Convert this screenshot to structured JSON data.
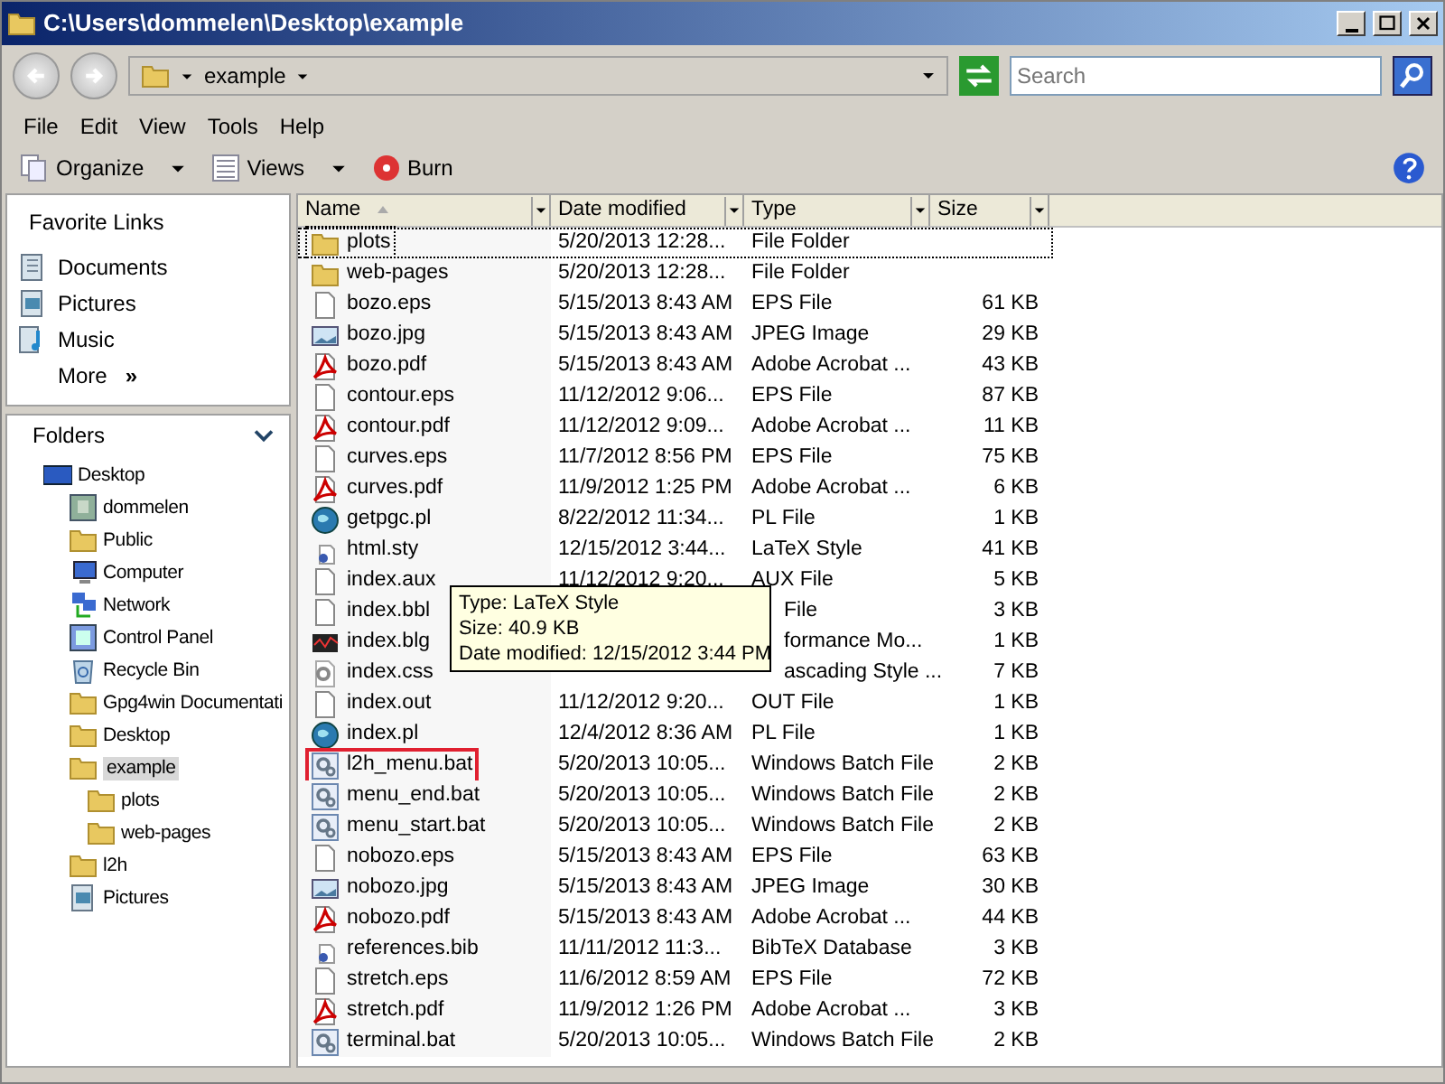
{
  "window": {
    "title": "C:\\Users\\dommelen\\Desktop\\example"
  },
  "address": {
    "path": "example",
    "search_placeholder": "Search"
  },
  "menu": [
    "File",
    "Edit",
    "View",
    "Tools",
    "Help"
  ],
  "toolbar": [
    {
      "label": "Organize",
      "kind": "menu"
    },
    {
      "label": "Views",
      "kind": "menu"
    },
    {
      "label": "Burn",
      "kind": "plain"
    }
  ],
  "favorites": {
    "title": "Favorite Links",
    "items": [
      {
        "label": "Documents",
        "kind": "documents"
      },
      {
        "label": "Pictures",
        "kind": "pictures"
      },
      {
        "label": "Music",
        "kind": "music"
      }
    ],
    "more": "More",
    "more_glyph": "»"
  },
  "folders": {
    "title": "Folders",
    "tree": [
      {
        "label": "Desktop",
        "kind": "desktop",
        "selected": false,
        "children": [
          {
            "label": "dommelen",
            "kind": "user",
            "selected": false
          },
          {
            "label": "Public",
            "kind": "folder",
            "selected": false
          },
          {
            "label": "Computer",
            "kind": "computer",
            "selected": false
          },
          {
            "label": "Network",
            "kind": "network",
            "selected": false
          },
          {
            "label": "Control Panel",
            "kind": "control",
            "selected": false
          },
          {
            "label": "Recycle Bin",
            "kind": "recycle",
            "selected": false
          },
          {
            "label": "Gpg4win Documentati",
            "kind": "folder",
            "selected": false
          },
          {
            "label": "Desktop",
            "kind": "folder",
            "selected": false
          },
          {
            "label": "example",
            "kind": "folder",
            "selected": true,
            "children": [
              {
                "label": "plots",
                "kind": "folder",
                "selected": false
              },
              {
                "label": "web-pages",
                "kind": "folder",
                "selected": false
              }
            ]
          },
          {
            "label": "l2h",
            "kind": "folder",
            "selected": false
          },
          {
            "label": "Pictures",
            "kind": "pictures",
            "selected": false
          }
        ]
      }
    ]
  },
  "columns": [
    {
      "label": "Name",
      "sorted": true
    },
    {
      "label": "Date modified",
      "sorted": false
    },
    {
      "label": "Type",
      "sorted": false
    },
    {
      "label": "Size",
      "sorted": false
    }
  ],
  "files": [
    {
      "name": "plots",
      "date": "5/20/2013 12:28...",
      "type": "File Folder",
      "kind": "folder",
      "focused": true,
      "highlighted": false
    },
    {
      "name": "web-pages",
      "date": "5/20/2013 12:28...",
      "type": "File Folder",
      "kind": "folder",
      "focused": false,
      "highlighted": false
    },
    {
      "name": "bozo.eps",
      "date": "5/15/2013 8:43 AM",
      "type": "EPS File",
      "size": "61 KB",
      "kind": "doc",
      "focused": false,
      "highlighted": false
    },
    {
      "name": "bozo.jpg",
      "date": "5/15/2013 8:43 AM",
      "type": "JPEG Image",
      "size": "29 KB",
      "kind": "image",
      "focused": false,
      "highlighted": false
    },
    {
      "name": "bozo.pdf",
      "date": "5/15/2013 8:43 AM",
      "type": "Adobe Acrobat ...",
      "size": "43 KB",
      "kind": "pdf",
      "focused": false,
      "highlighted": false
    },
    {
      "name": "contour.eps",
      "date": "11/12/2012 9:06...",
      "type": "EPS File",
      "size": "87 KB",
      "kind": "doc",
      "focused": false,
      "highlighted": false
    },
    {
      "name": "contour.pdf",
      "date": "11/12/2012 9:09...",
      "type": "Adobe Acrobat ...",
      "size": "11 KB",
      "kind": "pdf",
      "focused": false,
      "highlighted": false
    },
    {
      "name": "curves.eps",
      "date": "11/7/2012 8:56 PM",
      "type": "EPS File",
      "size": "75 KB",
      "kind": "doc",
      "focused": false,
      "highlighted": false
    },
    {
      "name": "curves.pdf",
      "date": "11/9/2012 1:25 PM",
      "type": "Adobe Acrobat ...",
      "size": "6 KB",
      "kind": "pdf",
      "focused": false,
      "highlighted": false
    },
    {
      "name": "getpgc.pl",
      "date": "8/22/2012 11:34...",
      "type": "PL File",
      "size": "1 KB",
      "kind": "globe",
      "focused": false,
      "highlighted": false
    },
    {
      "name": "html.sty",
      "date": "12/15/2012 3:44...",
      "type": "LaTeX Style",
      "size": "41 KB",
      "kind": "tex",
      "focused": false,
      "highlighted": false
    },
    {
      "name": "index.aux",
      "date": "11/12/2012 9:20...",
      "type": "AUX File",
      "size": "5 KB",
      "kind": "doc",
      "focused": false,
      "highlighted": false
    },
    {
      "name": "index.bbl",
      "type": "File",
      "size": "3 KB",
      "kind": "doc",
      "focused": false,
      "highlighted": false
    },
    {
      "name": "index.blg",
      "type": "formance Mo...",
      "size": "1 KB",
      "kind": "chart",
      "focused": false,
      "highlighted": false
    },
    {
      "name": "index.css",
      "type": "ascading Style ...",
      "size": "7 KB",
      "kind": "css",
      "focused": false,
      "highlighted": false
    },
    {
      "name": "index.out",
      "date": "11/12/2012 9:20...",
      "type": "OUT File",
      "size": "1 KB",
      "kind": "doc",
      "focused": false,
      "highlighted": false
    },
    {
      "name": "index.pl",
      "date": "12/4/2012 8:36 AM",
      "type": "PL File",
      "size": "1 KB",
      "kind": "globe",
      "focused": false,
      "highlighted": false
    },
    {
      "name": "l2h_menu.bat",
      "date": "5/20/2013 10:05...",
      "type": "Windows Batch File",
      "size": "2 KB",
      "kind": "bat",
      "focused": false,
      "highlighted": true
    },
    {
      "name": "menu_end.bat",
      "date": "5/20/2013 10:05...",
      "type": "Windows Batch File",
      "size": "2 KB",
      "kind": "bat",
      "focused": false,
      "highlighted": false
    },
    {
      "name": "menu_start.bat",
      "date": "5/20/2013 10:05...",
      "type": "Windows Batch File",
      "size": "2 KB",
      "kind": "bat",
      "focused": false,
      "highlighted": false
    },
    {
      "name": "nobozo.eps",
      "date": "5/15/2013 8:43 AM",
      "type": "EPS File",
      "size": "63 KB",
      "kind": "doc",
      "focused": false,
      "highlighted": false
    },
    {
      "name": "nobozo.jpg",
      "date": "5/15/2013 8:43 AM",
      "type": "JPEG Image",
      "size": "30 KB",
      "kind": "image",
      "focused": false,
      "highlighted": false
    },
    {
      "name": "nobozo.pdf",
      "date": "5/15/2013 8:43 AM",
      "type": "Adobe Acrobat ...",
      "size": "44 KB",
      "kind": "pdf",
      "focused": false,
      "highlighted": false
    },
    {
      "name": "references.bib",
      "date": "11/11/2012 11:3...",
      "type": "BibTeX Database",
      "size": "3 KB",
      "kind": "tex",
      "focused": false,
      "highlighted": false
    },
    {
      "name": "stretch.eps",
      "date": "11/6/2012 8:59 AM",
      "type": "EPS File",
      "size": "72 KB",
      "kind": "doc",
      "focused": false,
      "highlighted": false
    },
    {
      "name": "stretch.pdf",
      "date": "11/9/2012 1:26 PM",
      "type": "Adobe Acrobat ...",
      "size": "3 KB",
      "kind": "pdf",
      "focused": false,
      "highlighted": false
    },
    {
      "name": "terminal.bat",
      "date": "5/20/2013 10:05...",
      "type": "Windows Batch File",
      "size": "2 KB",
      "kind": "bat",
      "focused": false,
      "highlighted": false
    }
  ],
  "tooltip": {
    "lines": [
      "Type: LaTeX Style",
      "Size: 40.9 KB",
      "Date modified: 12/15/2012 3:44 PM"
    ]
  }
}
